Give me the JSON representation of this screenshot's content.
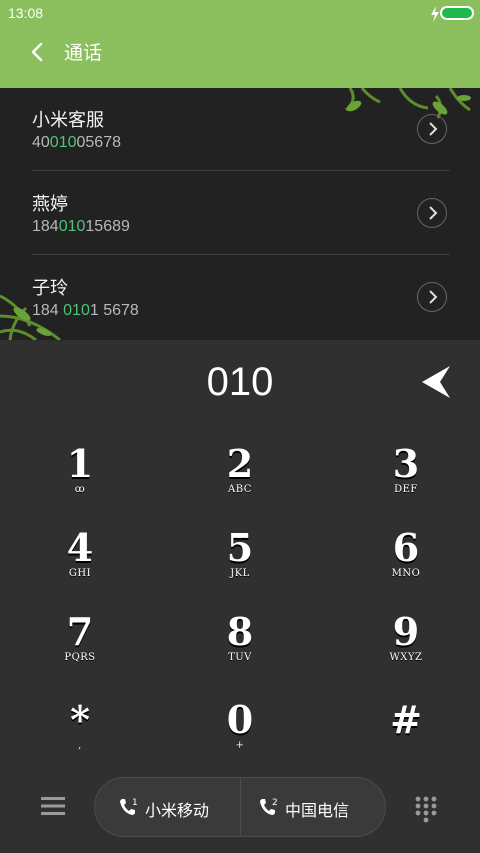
{
  "status": {
    "time": "13:08"
  },
  "header": {
    "title": "通话"
  },
  "contacts": [
    {
      "name": "小米客服",
      "number_pre": "40",
      "number_match": "010",
      "number_post": "05678"
    },
    {
      "name": "燕婷",
      "number_pre": "184",
      "number_match": "010",
      "number_post": "15689"
    },
    {
      "name": "子玲",
      "number_pre": "184 ",
      "number_match": "010",
      "number_post": "1 5678"
    }
  ],
  "dialer": {
    "input": "010"
  },
  "keys": [
    {
      "digit": "1",
      "letters": "ꝏ"
    },
    {
      "digit": "2",
      "letters": "ABC"
    },
    {
      "digit": "3",
      "letters": "DEF"
    },
    {
      "digit": "4",
      "letters": "GHI"
    },
    {
      "digit": "5",
      "letters": "JKL"
    },
    {
      "digit": "6",
      "letters": "MNO"
    },
    {
      "digit": "7",
      "letters": "PQRS"
    },
    {
      "digit": "8",
      "letters": "TUV"
    },
    {
      "digit": "9",
      "letters": "WXYZ"
    },
    {
      "digit": "*",
      "letters": ","
    },
    {
      "digit": "0",
      "letters": "+"
    },
    {
      "digit": "#",
      "letters": ""
    }
  ],
  "sim": [
    {
      "label": "小米移动",
      "slot": "1"
    },
    {
      "label": "中国电信",
      "slot": "2"
    }
  ],
  "colors": {
    "accent": "#8bbf5e",
    "match": "#4ec37a",
    "battery": "#1fb84a"
  }
}
